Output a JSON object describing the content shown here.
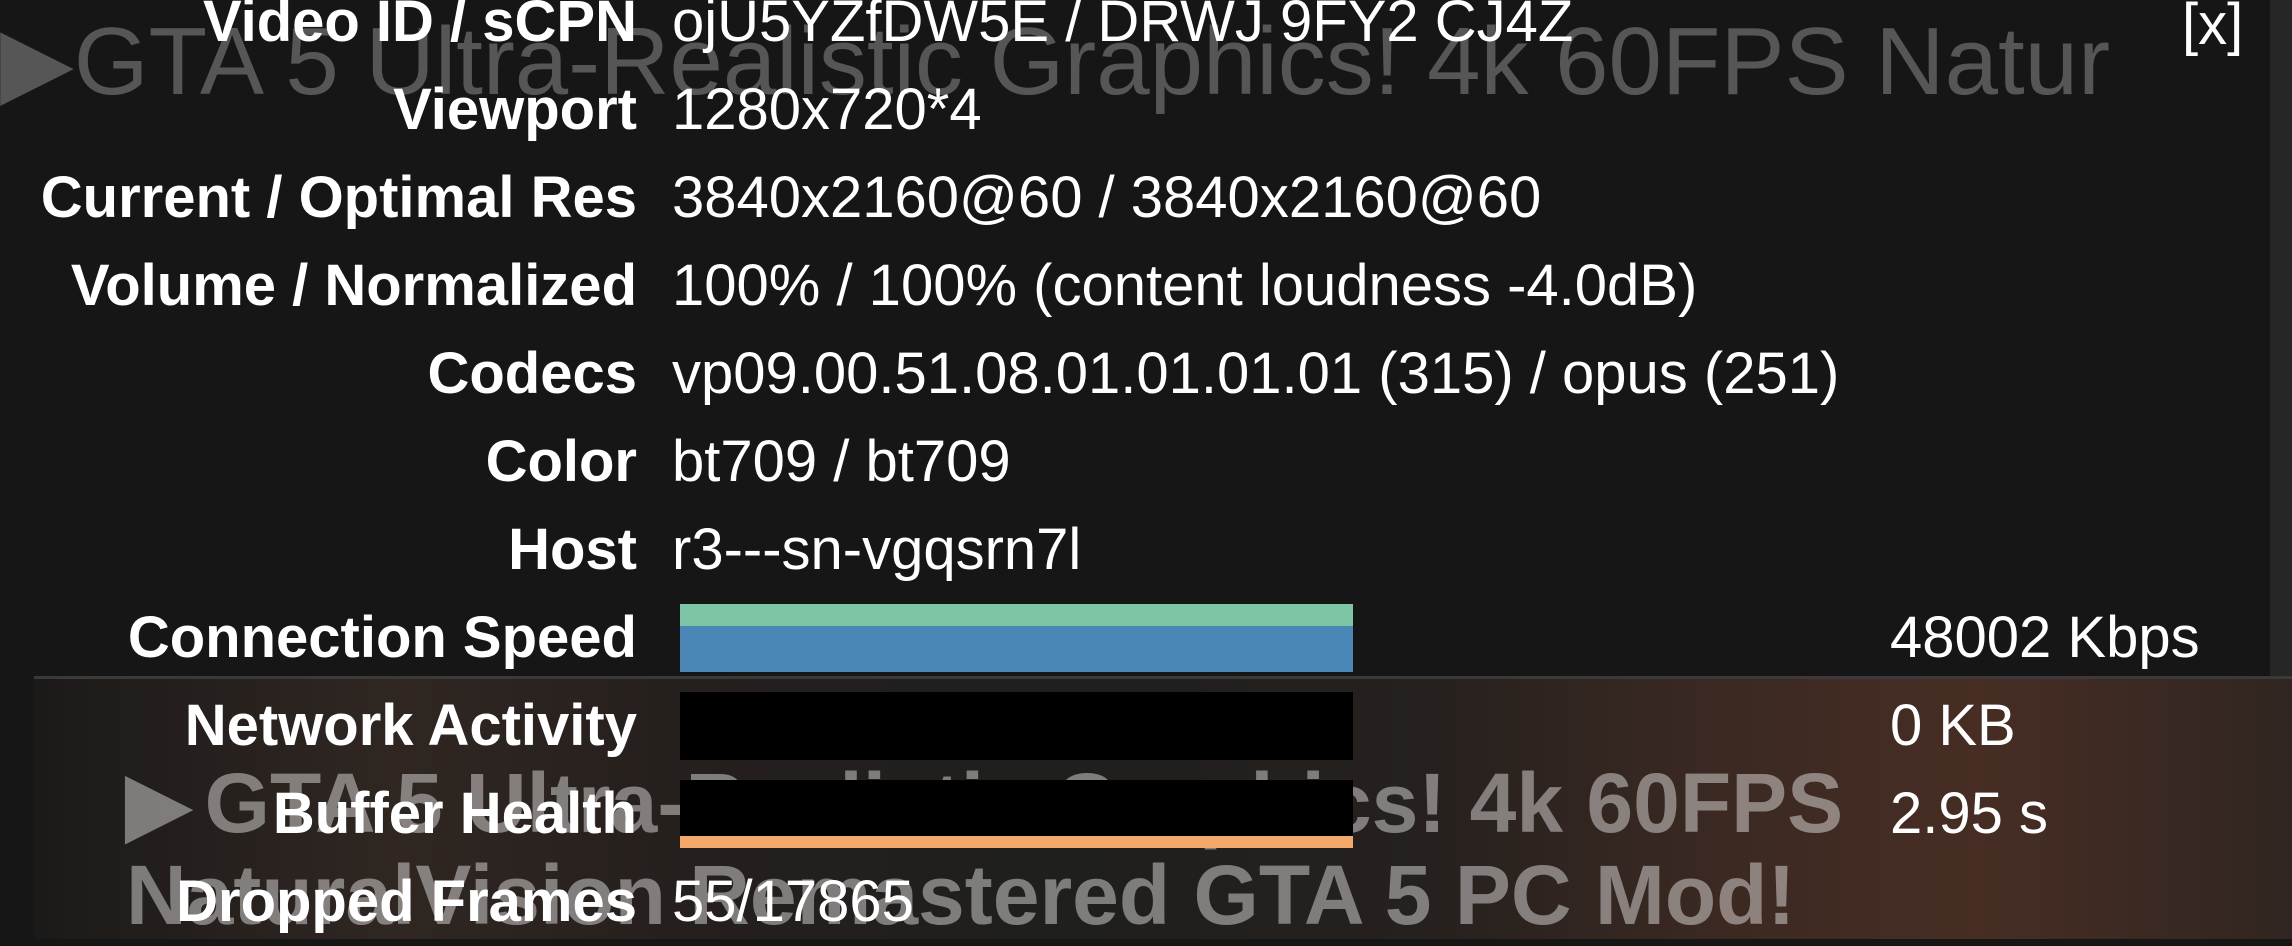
{
  "background": {
    "title": "▶GTA 5 Ultra-Realistic Graphics! 4k 60FPS Natur",
    "thumbnail_title_line1": "GTA 5 Ultra-Realistic Graphics! 4k 60FPS",
    "thumbnail_title_line2": "NaturalVision Remastered GTA 5 PC Mod!",
    "play_glyph": "▶"
  },
  "overlay": {
    "close_label": "[x]",
    "rows": [
      {
        "label": "Video ID / sCPN",
        "value": "ojU5YZfDW5E / DRWJ 9FY2 CJ4Z"
      },
      {
        "label": "Viewport",
        "value": "1280x720*4"
      },
      {
        "label": "Current / Optimal Res",
        "value": "3840x2160@60 / 3840x2160@60"
      },
      {
        "label": "Volume / Normalized",
        "value": "100% / 100% (content loudness -4.0dB)"
      },
      {
        "label": "Codecs",
        "value": "vp09.00.51.08.01.01.01.01 (315) / opus (251)"
      },
      {
        "label": "Color",
        "value": "bt709 / bt709"
      },
      {
        "label": "Host",
        "value": "r3---sn-vgqsrn7l"
      }
    ],
    "connection_speed": {
      "label": "Connection Speed",
      "value": "48002 Kbps"
    },
    "network_activity": {
      "label": "Network Activity",
      "value": "0 KB"
    },
    "buffer_health": {
      "label": "Buffer Health",
      "value": "2.95 s"
    },
    "dropped_frames": {
      "label": "Dropped Frames",
      "value": "55/17865"
    }
  },
  "colors": {
    "connection_top": "#7dc5a4",
    "connection_bar": "#4a86b6",
    "buffer_line": "#f4a86a",
    "panel_bg": "#161616"
  }
}
